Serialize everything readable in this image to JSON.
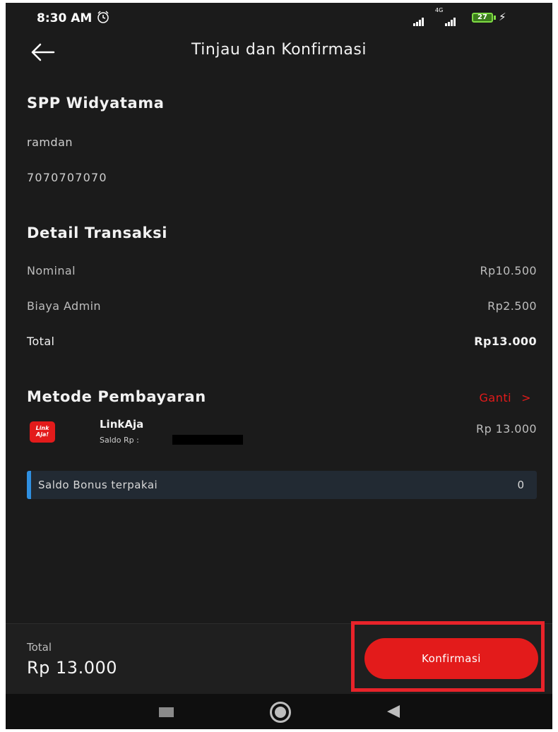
{
  "status_bar": {
    "time": "8:30 AM",
    "network": "4G",
    "battery": "27"
  },
  "header": {
    "title": "Tinjau dan Konfirmasi"
  },
  "biller": {
    "name": "SPP Widyatama",
    "customer_name": "ramdan",
    "customer_id": "7070707070"
  },
  "detail": {
    "heading": "Detail Transaksi",
    "rows": [
      {
        "label": "Nominal",
        "value": "Rp10.500"
      },
      {
        "label": "Biaya Admin",
        "value": "Rp2.500"
      },
      {
        "label": "Total",
        "value": "Rp13.000"
      }
    ]
  },
  "payment": {
    "heading": "Metode Pembayaran",
    "change_label": "Ganti",
    "change_chevron": ">",
    "method_logo_text": "Link Aja!",
    "method_name": "LinkAja",
    "balance_label": "Saldo Rp :",
    "method_amount": "Rp 13.000",
    "bonus_label": "Saldo Bonus terpakai",
    "bonus_value": "0"
  },
  "footer": {
    "total_label": "Total",
    "total_value": "Rp 13.000",
    "confirm_label": "Konfirmasi"
  },
  "colors": {
    "accent": "#e31b1b",
    "background": "#1b1b1b",
    "bonus_bar": "#2f8fe0"
  },
  "icons": {
    "back": "arrow-left-icon",
    "alarm": "alarm-clock-icon",
    "nav_recents": "square-icon",
    "nav_home": "circle-icon",
    "nav_back": "triangle-back-icon"
  }
}
